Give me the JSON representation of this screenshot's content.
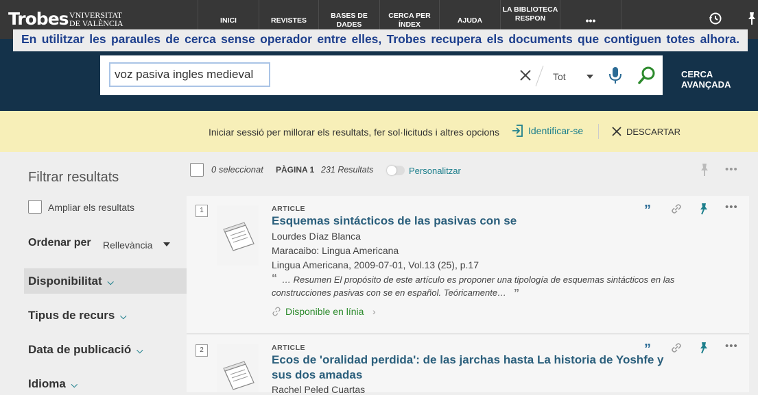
{
  "topbar": {
    "logo": "Trobes",
    "university": [
      "VNIVERSITAT",
      "DE VALÈNCIA"
    ],
    "nav": [
      "INICI",
      "REVISTES",
      "BASES DE DADES",
      "CERCA PER ÍNDEX",
      "AJUDA",
      "LA BIBLIOTECA RESPON",
      "•••"
    ]
  },
  "banner": {
    "text": "En utilitzar les paraules de cerca sense operador entre elles, Trobes recupera els documents que contiguen totes alhora."
  },
  "search": {
    "query": "voz pasiva ingles medieval",
    "scope": "Tot",
    "advanced": "CERCA AVANÇADA"
  },
  "login": {
    "message": "Iniciar sessió per millorar els resultats, fer sol·licituds i altres opcions",
    "signin": "Identificar-se",
    "dismiss": "DESCARTAR"
  },
  "filters": {
    "title": "Filtrar resultats",
    "expand": "Ampliar els resultats",
    "sort_label": "Ordenar per",
    "sort_value": "Rellevància",
    "facets": [
      "Disponibilitat",
      "Tipus de recurs",
      "Data de publicació",
      "Idioma"
    ]
  },
  "toolbar": {
    "selected": "0 seleccionat",
    "page": "PÀGINA 1",
    "count": "231 Resultats",
    "personalize": "Personalitzar"
  },
  "results": [
    {
      "num": "1",
      "type": "ARTICLE",
      "title": "Esquemas sintácticos de las pasivas con se",
      "author": "Lourdes Díaz Blanca",
      "publisher": "Maracaibo: Lingua Americana",
      "source": "Lingua Americana, 2009-07-01, Vol.13 (25), p.17",
      "snippet1": "…  Resumen El propósito de este artículo es proponer una tipología de esquemas sintácticos en las",
      "snippet2": "construcciones pasivas con se en español. Teóricamente…",
      "availability": "Disponible en línia"
    },
    {
      "num": "2",
      "type": "ARTICLE",
      "title1": "Ecos de 'oralidad perdida': de las jarchas hasta La historia de Yoshfe y",
      "title2": "sus dos amadas",
      "author": "Rachel Peled Cuartas"
    }
  ],
  "colors": {
    "topbar": "#373737",
    "hero": "#14324a",
    "banner_text": "#1d3f8d",
    "login_bar": "#f7efb8",
    "accent": "#1d7f8c"
  }
}
